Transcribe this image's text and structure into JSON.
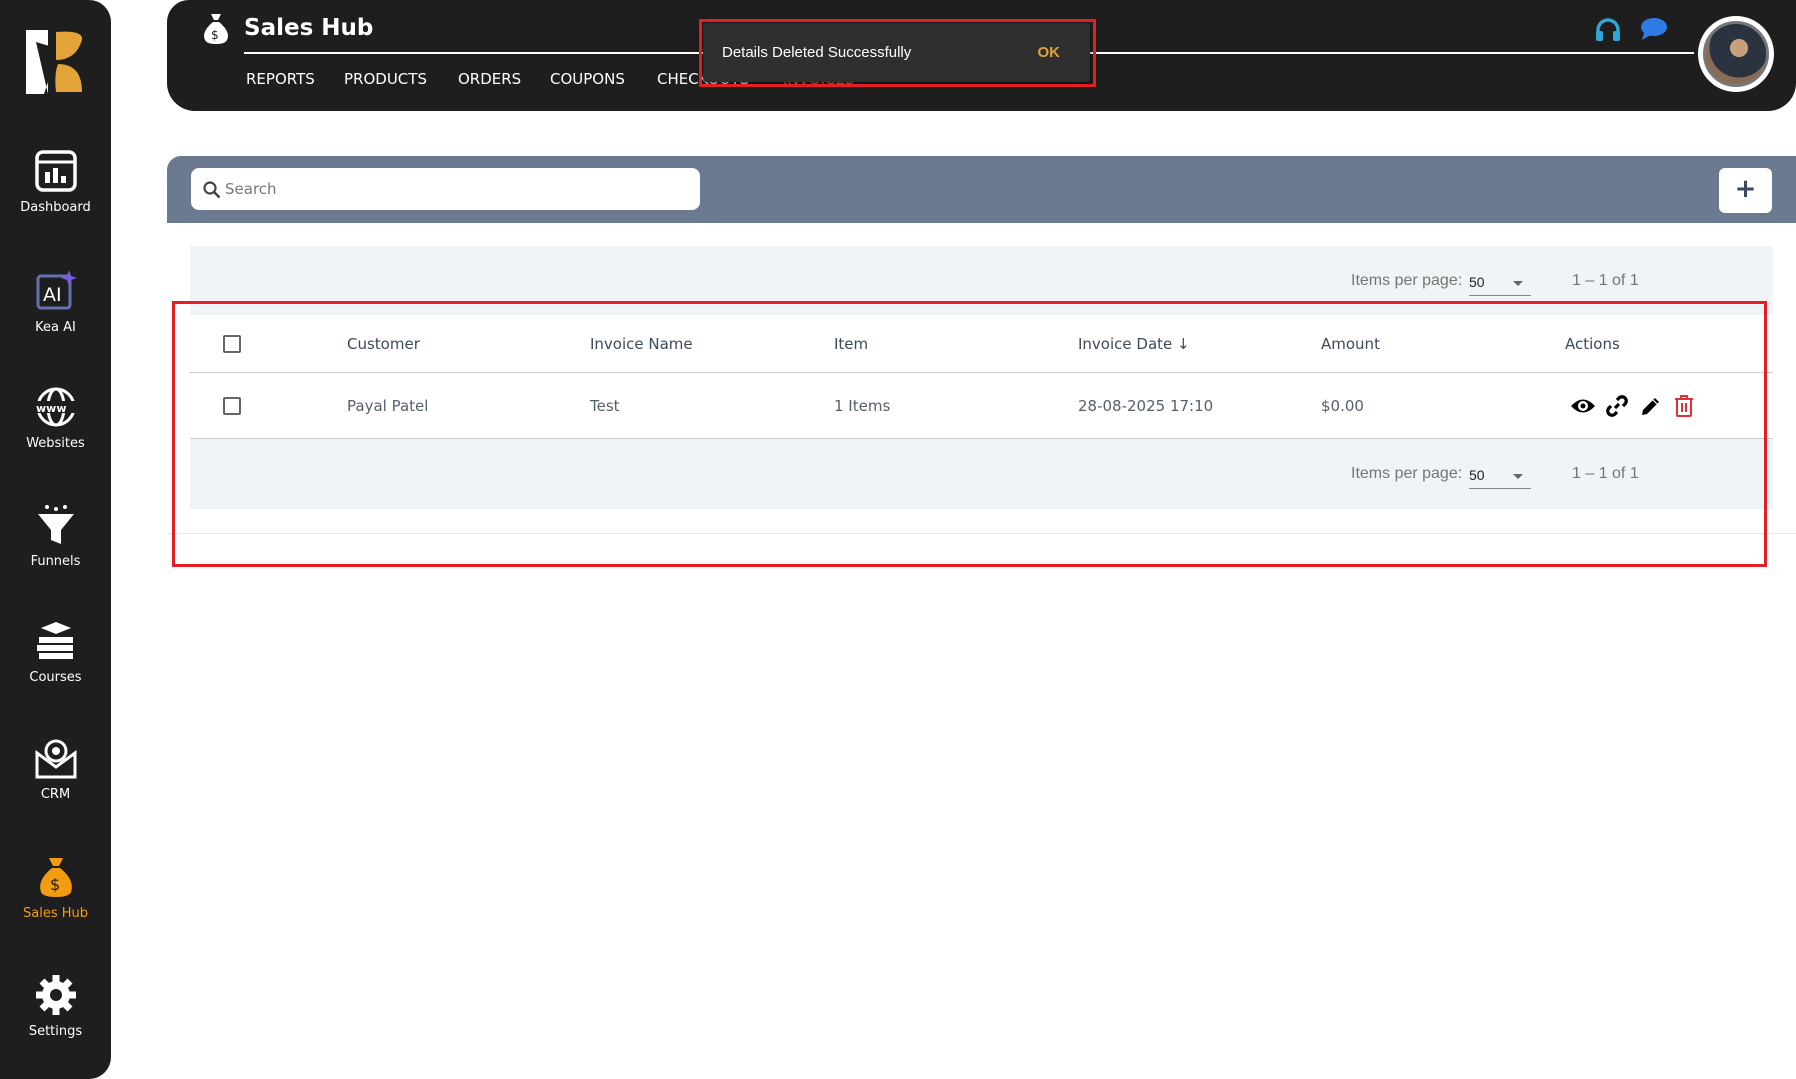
{
  "sidebar": {
    "items": [
      {
        "label": "Dashboard",
        "icon": "dashboard-icon"
      },
      {
        "label": "Kea AI",
        "icon": "ai-icon"
      },
      {
        "label": "Websites",
        "icon": "www-icon"
      },
      {
        "label": "Funnels",
        "icon": "funnel-icon"
      },
      {
        "label": "Courses",
        "icon": "courses-icon"
      },
      {
        "label": "CRM",
        "icon": "crm-icon"
      },
      {
        "label": "Sales Hub",
        "icon": "money-bag-icon",
        "active": true
      },
      {
        "label": "Settings",
        "icon": "gear-icon"
      }
    ]
  },
  "header": {
    "title": "Sales Hub",
    "tabs": [
      "REPORTS",
      "PRODUCTS",
      "ORDERS",
      "COUPONS",
      "CHECKOUTS",
      "INVOICES"
    ],
    "active_tab": "INVOICES"
  },
  "toast": {
    "message": "Details Deleted Successfully",
    "action": "OK"
  },
  "search": {
    "placeholder": "Search"
  },
  "add_button": "+",
  "pager": {
    "items_per_page_label": "Items per page:",
    "page_size": "50",
    "range": "1 – 1 of 1"
  },
  "table": {
    "columns": [
      "Customer",
      "Invoice Name",
      "Item",
      "Invoice Date",
      "Amount",
      "Actions"
    ],
    "sort_indicator": "↓",
    "rows": [
      {
        "customer": "Payal Patel",
        "invoice_name": "Test",
        "item": "1 Items",
        "invoice_date": "28-08-2025 17:10",
        "amount": "$0.00"
      }
    ]
  },
  "colors": {
    "accent": "#f39c12",
    "toolbar": "#6c7a91",
    "highlight": "#e31e24",
    "delete": "#e0313b"
  }
}
